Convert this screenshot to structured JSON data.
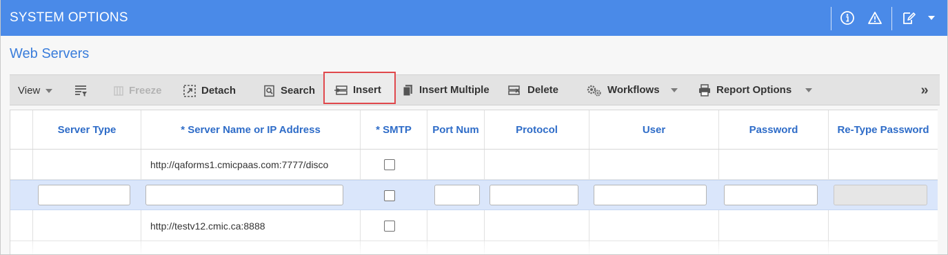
{
  "window": {
    "title": "SYSTEM OPTIONS",
    "icons": [
      "info-icon",
      "warning-icon",
      "edit-note-icon",
      "dropdown-caret-icon"
    ]
  },
  "section": {
    "title": "Web Servers"
  },
  "toolbar": {
    "view": "View",
    "freeze": "Freeze",
    "detach": "Detach",
    "search": "Search",
    "insert": "Insert",
    "insert_multiple": "Insert Multiple",
    "delete": "Delete",
    "workflows": "Workflows",
    "report_options": "Report Options",
    "more": "»"
  },
  "grid": {
    "columns": [
      "Server Type",
      "* Server Name or IP Address",
      "* SMTP",
      "Port Num",
      "Protocol",
      "User",
      "Password",
      "Re-Type Password"
    ],
    "rows": [
      {
        "server_type": "",
        "server_name": "http://qaforms1.cmicpaas.com:7777/disco",
        "smtp": false,
        "port": "",
        "protocol": "",
        "user": "",
        "password": "",
        "retype": ""
      },
      {
        "server_type": "",
        "server_name": "",
        "smtp": false,
        "port": "",
        "protocol": "",
        "user": "",
        "password": "",
        "retype": "",
        "editing": true
      },
      {
        "server_type": "",
        "server_name": "http://testv12.cmic.ca:8888",
        "smtp": false,
        "port": "",
        "protocol": "",
        "user": "",
        "password": "",
        "retype": ""
      }
    ]
  },
  "colors": {
    "title_bar": "#4a8ae8",
    "accent_text": "#3a7ddb",
    "header_text": "#2e6cc8",
    "selected_row": "#dae6fb",
    "highlight_box": "#e0474b"
  }
}
